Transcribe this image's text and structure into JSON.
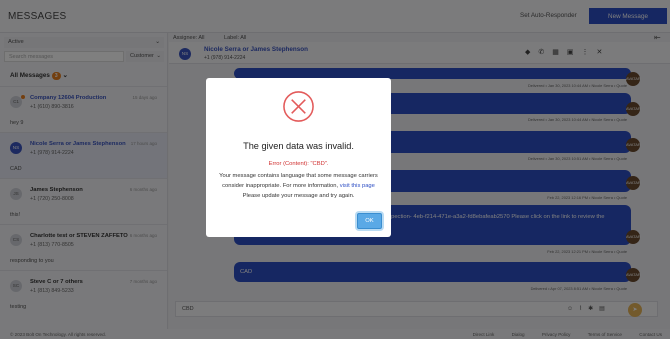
{
  "header": {
    "title": "MESSAGES",
    "auto_responder": "Set Auto-Responder",
    "new_message": "New Message"
  },
  "sidebar": {
    "filter": "Active",
    "search_placeholder": "Search messages",
    "customer_filter": "Customer",
    "all_messages": "All Messages",
    "all_count": "3",
    "conversations": [
      {
        "initials": "C1",
        "name": "Company 12604 Production",
        "phone": "+1 (610) 890-3816",
        "time": "15 days ago",
        "preview": "hey 9"
      },
      {
        "initials": "NS",
        "name": "Nicole Serra or James Stephenson",
        "phone": "+1 (978) 914-2224",
        "time": "17 hours ago",
        "preview": "CAD"
      },
      {
        "initials": "JS",
        "name": "James Stephenson",
        "phone": "+1 (720) 250-8008",
        "time": "6 months ago",
        "preview": "this!"
      },
      {
        "initials": "CS",
        "name": "Charlotte test or STEVEN ZAFFETO",
        "phone": "+1 (813) 770-8505",
        "time": "6 months ago",
        "preview": "responding to you"
      },
      {
        "initials": "SC",
        "name": "Steve C or 7 others",
        "phone": "+1 (813) 849-5233",
        "time": "7 months ago",
        "preview": "testing"
      }
    ]
  },
  "chat": {
    "tabs": [
      "Assignee: All",
      "Label: All"
    ],
    "contact_initials": "NS",
    "contact_name": "Nicole Serra or James Stephenson",
    "contact_phone": "+1 (978) 914-2224",
    "metas": [
      "Delivered • Jan 30, 2023 10:44 AM • Nicole Serra • Quote",
      "Delivered • Jan 30, 2023 10:44 AM • Nicole Serra • Quote",
      "Delivered • Jan 30, 2023 10:51 AM • Nicole Serra • Quote",
      "Feb 22, 2023 12:16 PM • Nicole Serra • Quote",
      "Feb 22, 2023 12:21 PM • Nicole Serra • Quote",
      "Delivered • Apr 07, 2023 8:51 AM • Nicole Serra • Quote"
    ],
    "long_message": "rks Automotive. https://v3.staging.myshopmanager.com/inspection-  4eb-f214-471e-a3a2-fd8ebafeab2570 Please click on the link to review the technician's",
    "long_message_tail": "about your vehicle.",
    "cad_message": "CAD",
    "input_value": "CBD",
    "avatar_label": "AVATAR"
  },
  "modal": {
    "title": "The given data was invalid.",
    "error": "Error (Content): \"CBD\".",
    "body": "Your message contains language that some message carriers consider inappropriate. For more information,",
    "link": "visit this page",
    "body2": "Please update your message and try again.",
    "ok": "OK"
  },
  "footer": {
    "copy": "© 2023 Bolt On Technology. All rights reserved.",
    "links": [
      "Direct Link",
      "Dialog",
      "Privacy Policy",
      "Terms of Service",
      "Contact Us"
    ]
  }
}
